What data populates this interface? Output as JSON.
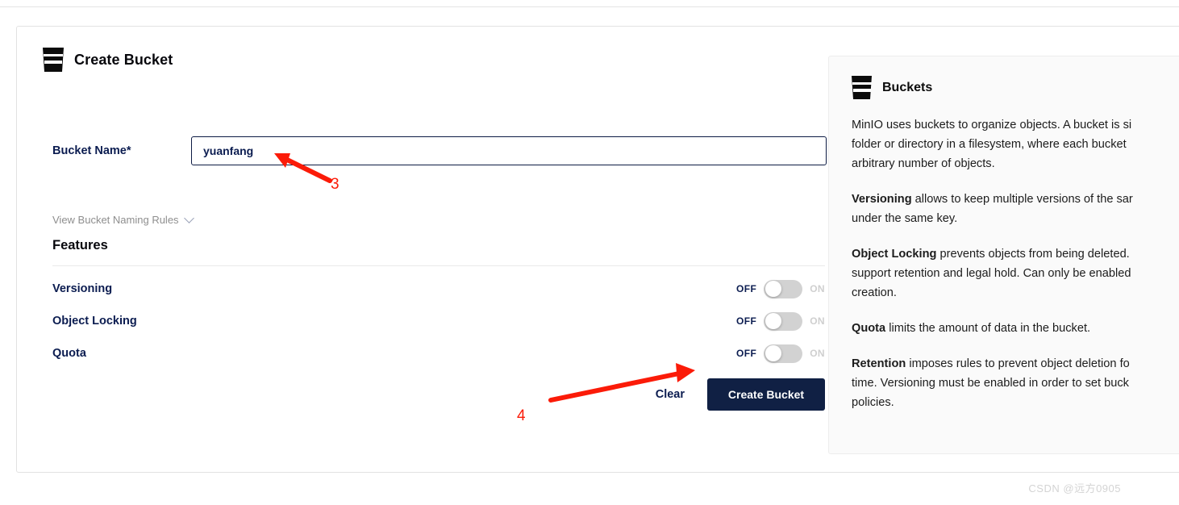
{
  "form": {
    "icon": "bucket-icon",
    "title": "Create Bucket",
    "bucket_name_label": "Bucket Name*",
    "bucket_name_value": "yuanfang",
    "bucket_name_placeholder": "",
    "naming_rules_link": "View Bucket Naming Rules",
    "naming_rules_chevron": "chevron-down-icon",
    "features_heading": "Features",
    "toggles": [
      {
        "label": "Versioning",
        "off_label": "OFF",
        "on_label": "ON",
        "state": "off"
      },
      {
        "label": "Object Locking",
        "off_label": "OFF",
        "on_label": "ON",
        "state": "off"
      },
      {
        "label": "Quota",
        "off_label": "OFF",
        "on_label": "ON",
        "state": "off"
      }
    ],
    "clear_label": "Clear",
    "submit_label": "Create Bucket"
  },
  "info_panel": {
    "icon": "bucket-icon",
    "title": "Buckets",
    "paragraphs": [
      {
        "lines": [
          {
            "bold": "",
            "text": "MinIO uses buckets to organize objects. A bucket is si"
          },
          {
            "bold": "",
            "text": "folder or directory in a filesystem, where each bucket"
          },
          {
            "bold": "",
            "text": "arbitrary number of objects."
          }
        ]
      },
      {
        "lines": [
          {
            "bold": "Versioning",
            "text": " allows to keep multiple versions of the sar"
          },
          {
            "bold": "",
            "text": "under the same key."
          }
        ]
      },
      {
        "lines": [
          {
            "bold": "Object Locking",
            "text": " prevents objects from being deleted."
          },
          {
            "bold": "",
            "text": "support retention and legal hold. Can only be enabled"
          },
          {
            "bold": "",
            "text": "creation."
          }
        ]
      },
      {
        "lines": [
          {
            "bold": "Quota",
            "text": " limits the amount of data in the bucket."
          }
        ]
      },
      {
        "lines": [
          {
            "bold": "Retention",
            "text": " imposes rules to prevent object deletion fo"
          },
          {
            "bold": "",
            "text": "time. Versioning must be enabled in order to set buck"
          },
          {
            "bold": "",
            "text": "policies."
          }
        ]
      }
    ]
  },
  "annotations": {
    "color": "#fb1b08",
    "markers": [
      {
        "number": "3",
        "points_to": "bucket-name-input"
      },
      {
        "number": "4",
        "points_to": "create-bucket-button"
      }
    ]
  },
  "watermark": "CSDN @远方0905"
}
